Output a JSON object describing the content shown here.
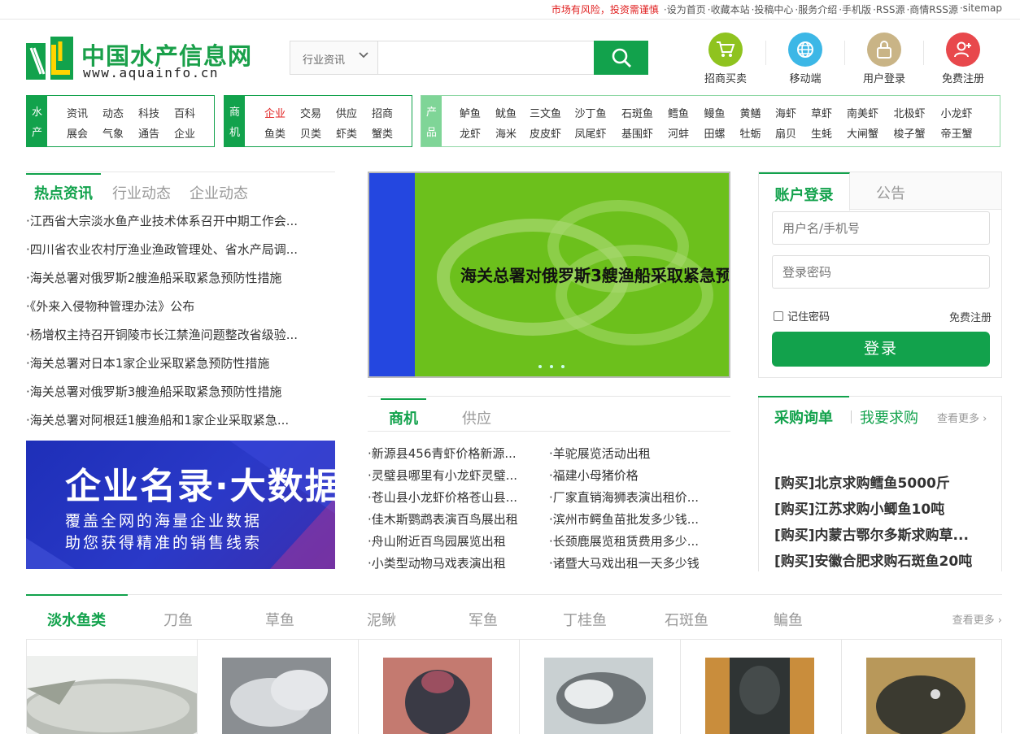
{
  "topbar": {
    "risk": "市场有风险，投资需谨慎",
    "links": [
      "·设为首页",
      "·收藏本站",
      "·投稿中心",
      "·服务介绍",
      "·手机版",
      "·RSS源",
      "·商情RSS源",
      "·sitemap"
    ]
  },
  "logo": {
    "cn": "中国水产信息网",
    "en": "www.aquainfo.cn"
  },
  "search": {
    "category": "行业资讯",
    "placeholder": ""
  },
  "quick": [
    {
      "label": "招商买卖",
      "color": "#8fc31f",
      "icon": "cart-icon"
    },
    {
      "label": "移动端",
      "color": "#3cb7e6",
      "icon": "globe-icon"
    },
    {
      "label": "用户登录",
      "color": "#c9b486",
      "icon": "lock-icon"
    },
    {
      "label": "免费注册",
      "color": "#e8484c",
      "icon": "add-user-icon"
    }
  ],
  "nav": {
    "aquatic": {
      "tag": [
        "水",
        "产"
      ],
      "rows": [
        [
          "资讯",
          "动态",
          "科技",
          "百科"
        ],
        [
          "展会",
          "气象",
          "通告",
          "企业"
        ]
      ]
    },
    "business": {
      "tag": [
        "商",
        "机"
      ],
      "rows": [
        [
          "企业",
          "交易",
          "供应",
          "招商"
        ],
        [
          "鱼类",
          "贝类",
          "虾类",
          "蟹类"
        ]
      ]
    },
    "products": {
      "tag": [
        "产",
        "品"
      ],
      "rows": [
        [
          "鲈鱼",
          "鱿鱼",
          "三文鱼",
          "沙丁鱼",
          "石斑鱼",
          "鳕鱼",
          "鳗鱼",
          "黄鳝",
          "海虾",
          "草虾",
          "南美虾",
          "北极虾",
          "小龙虾"
        ],
        [
          "龙虾",
          "海米",
          "皮皮虾",
          "凤尾虾",
          "基围虾",
          "河蚌",
          "田螺",
          "牡蛎",
          "扇贝",
          "生蚝",
          "大闸蟹",
          "梭子蟹",
          "帝王蟹"
        ]
      ]
    }
  },
  "news": {
    "tabs": [
      "热点资讯",
      "行业动态",
      "企业动态"
    ],
    "items": [
      "·江西省大宗淡水鱼产业技术体系召开中期工作会...",
      "·四川省农业农村厅渔业渔政管理处、省水产局调...",
      "·海关总署对俄罗斯2艘渔船采取紧急预防性措施",
      "·《外来入侵物种管理办法》公布",
      "·杨增权主持召开铜陵市长江禁渔问题整改省级验...",
      "·海关总署对日本1家企业采取紧急预防性措施",
      "·海关总署对俄罗斯3艘渔船采取紧急预防性措施",
      "·海关总署对阿根廷1艘渔船和1家企业采取紧急..."
    ]
  },
  "ad": {
    "title": "企业名录·大数据",
    "line1": "覆盖全网的海量企业数据",
    "line2": "助您获得精准的销售线索"
  },
  "slider": {
    "caption": "海关总署对俄罗斯3艘渔船采取紧急预防性措"
  },
  "login": {
    "tabs": [
      "账户登录",
      "公告"
    ],
    "user_placeholder": "用户名/手机号",
    "pass_placeholder": "登录密码",
    "remember": "记住密码",
    "register": "免费注册",
    "button": "登录"
  },
  "biz": {
    "tabs": [
      "商机",
      "供应"
    ],
    "rows": [
      [
        "·新源县456青虾价格新源...",
        "·羊驼展览活动出租"
      ],
      [
        "·灵璧县哪里有小龙虾灵璧...",
        "·福建小母猪价格"
      ],
      [
        "·苍山县小龙虾价格苍山县...",
        "·厂家直销海狮表演出租价..."
      ],
      [
        "·佳木斯鹦鹉表演百鸟展出租",
        "·滨州市鳄鱼苗批发多少钱..."
      ],
      [
        "·舟山附近百鸟园展览出租",
        "·长颈鹿展览租赁费用多少..."
      ],
      [
        "·小类型动物马戏表演出租",
        "·诸暨大马戏出租一天多少钱"
      ]
    ]
  },
  "purchase": {
    "title": "采购询单",
    "want": "我要求购",
    "more": "查看更多",
    "items": [
      "[购买]北京求购鳕鱼5000斤",
      "[购买]江苏求购小鲫鱼10吨",
      "[购买]内蒙古鄂尔多斯求购草...",
      "[购买]安徽合肥求购石斑鱼20吨"
    ]
  },
  "fresh": {
    "tabs": [
      "淡水鱼类",
      "刀鱼",
      "草鱼",
      "泥鳅",
      "军鱼",
      "丁桂鱼",
      "石斑鱼",
      "鳊鱼"
    ],
    "more": "查看更多"
  }
}
